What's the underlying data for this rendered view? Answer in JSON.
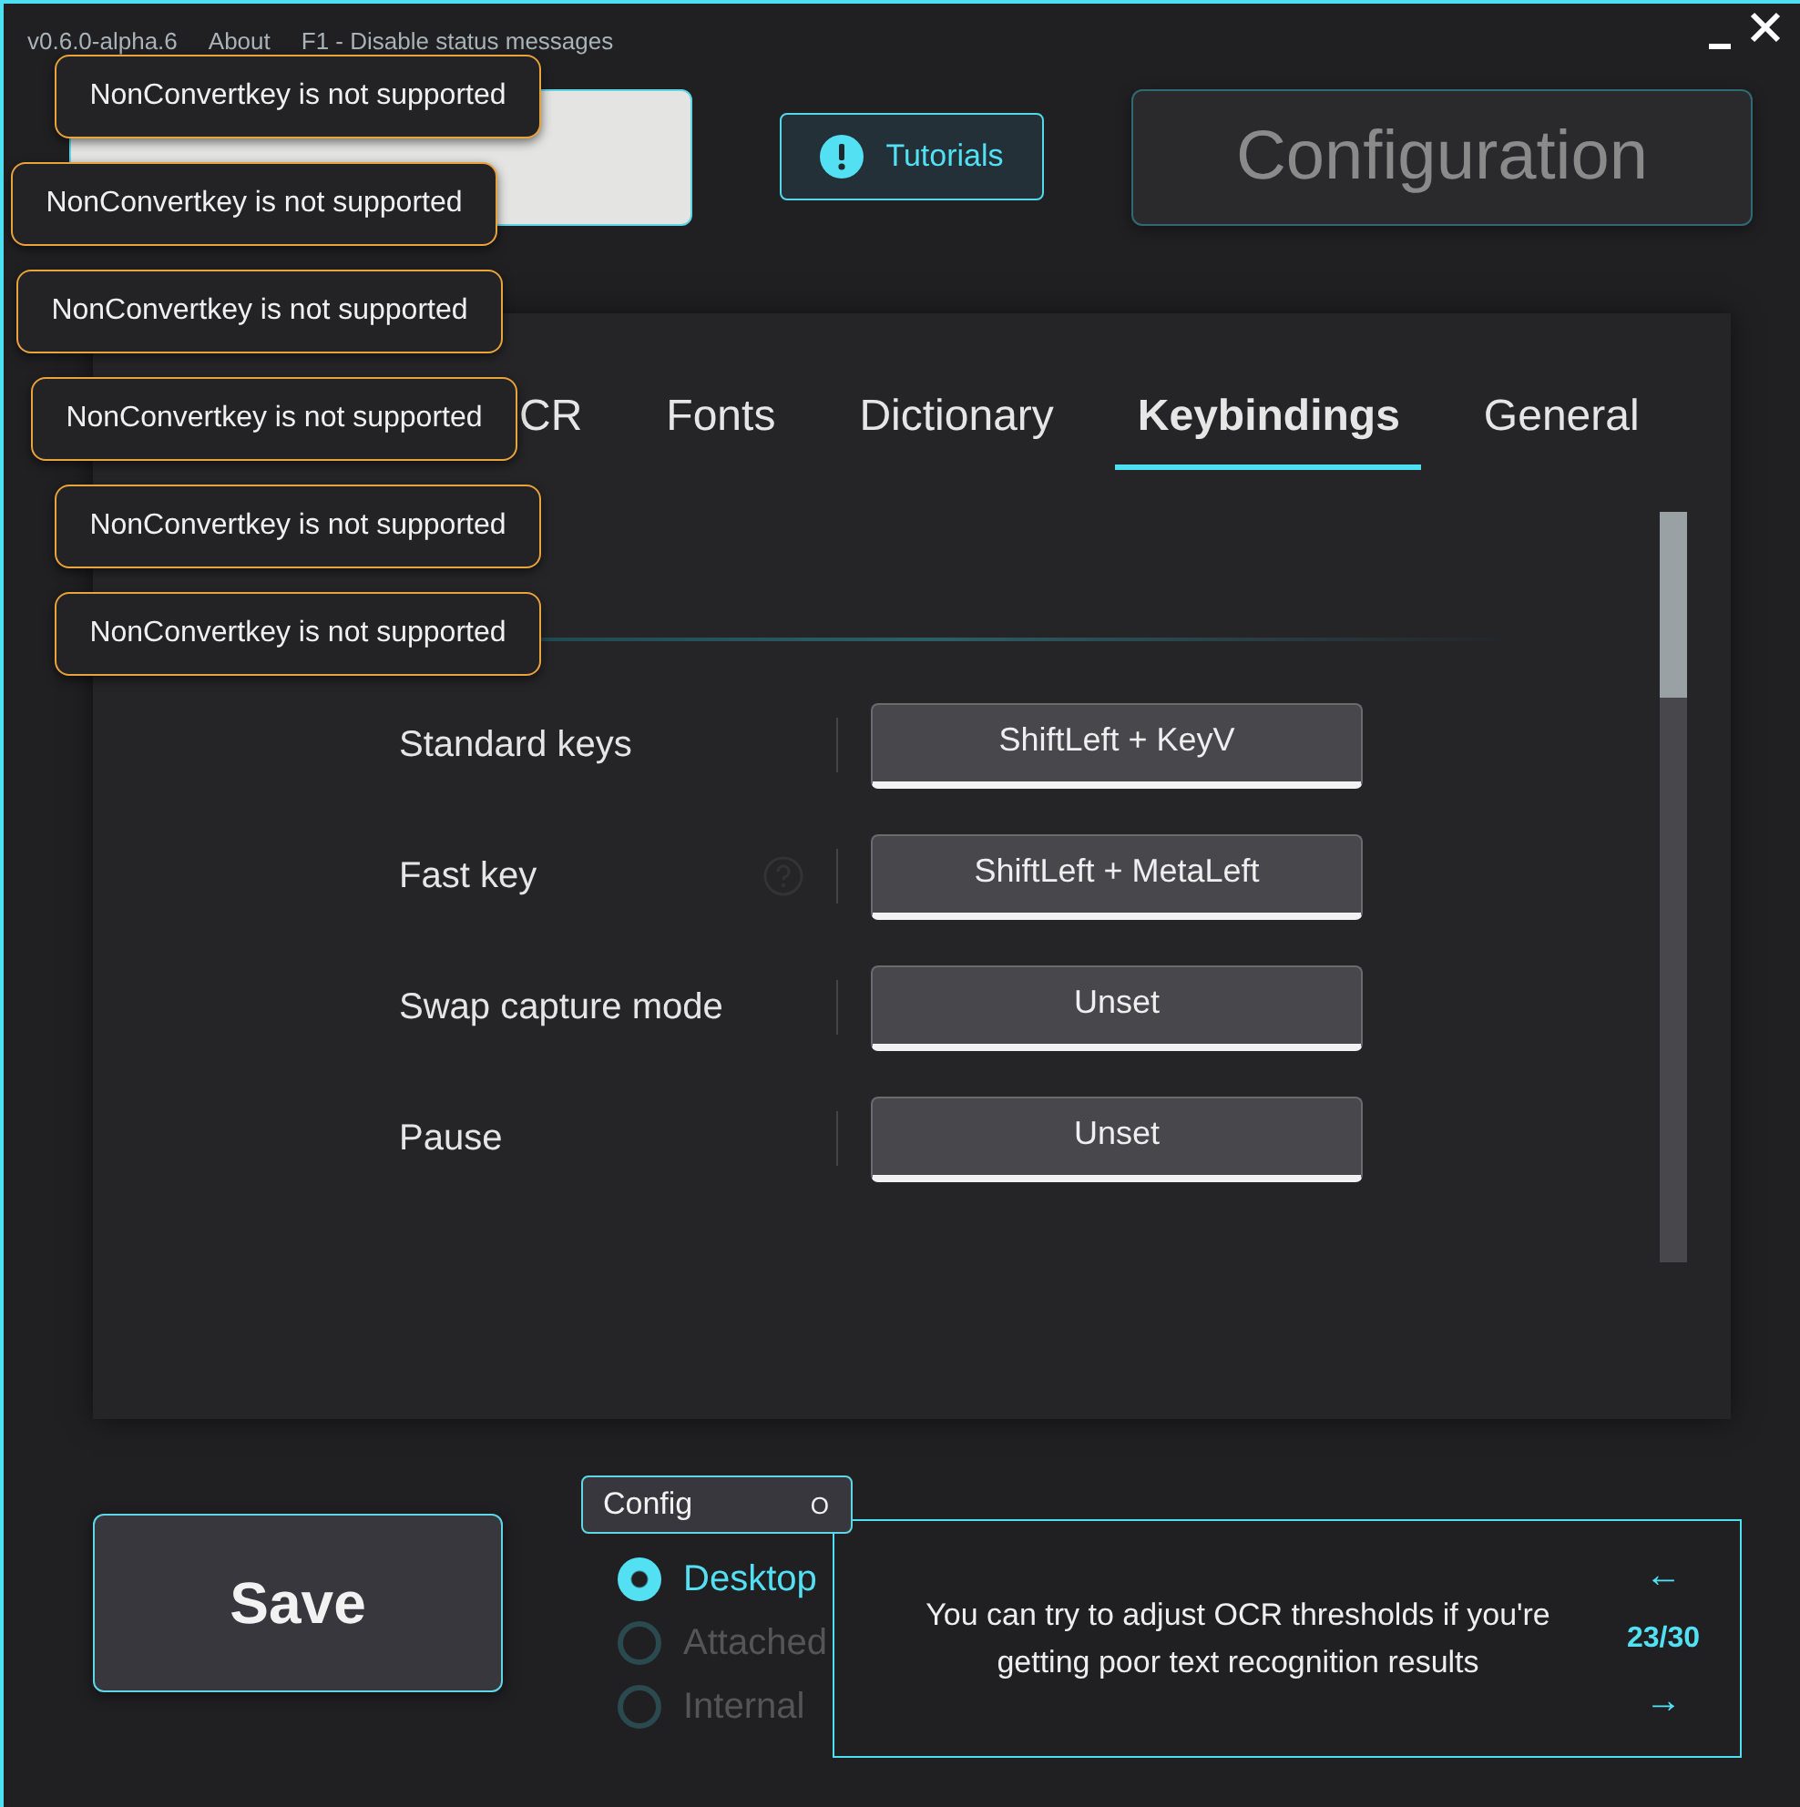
{
  "top_bar": {
    "version": "v0.6.0-alpha.6",
    "links": [
      "About",
      "F1 - Disable status messages"
    ]
  },
  "nav": {
    "tutorials": "Tutorials",
    "configuration": "Configuration"
  },
  "tabs": [
    {
      "label": "CR",
      "selected": false
    },
    {
      "label": "Fonts",
      "selected": false
    },
    {
      "label": "Dictionary",
      "selected": false
    },
    {
      "label": "Keybindings",
      "selected": true
    },
    {
      "label": "General",
      "selected": false
    }
  ],
  "keybindings": [
    {
      "label": "Standard keys",
      "value": "ShiftLeft + KeyV",
      "help": false
    },
    {
      "label": "Fast key",
      "value": "ShiftLeft + MetaLeft",
      "help": true
    },
    {
      "label": "Swap capture mode",
      "value": "Unset",
      "help": false
    },
    {
      "label": "Pause",
      "value": "Unset",
      "help": false
    }
  ],
  "save": "Save",
  "config_select": {
    "value": "Config",
    "indicator": "O"
  },
  "capture_modes": [
    {
      "label": "Desktop",
      "selected": true
    },
    {
      "label": "Attached",
      "selected": false
    },
    {
      "label": "Internal",
      "selected": false
    }
  ],
  "tip": {
    "text": "You can try to adjust OCR thresholds if you're getting poor text recognition results",
    "prev": "←",
    "counter": "23/30",
    "next": "→"
  },
  "toasts": [
    "NonConvertkey is not supported",
    "NonConvertkey is not supported",
    "NonConvertkey is not supported",
    "NonConvertkey is not supported",
    "NonConvertkey is not supported",
    "NonConvertkey is not supported"
  ]
}
